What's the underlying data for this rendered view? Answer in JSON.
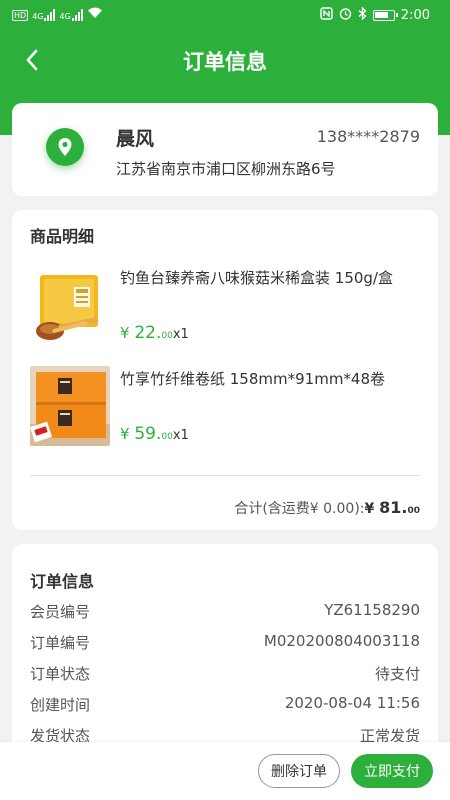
{
  "status_bar": {
    "time": "2:00",
    "network_badge": "HD",
    "signal_label_1": "4G",
    "signal_label_2": "4G"
  },
  "header": {
    "title": "订单信息",
    "back_icon": "chevron-left-icon"
  },
  "address": {
    "icon": "location-pin-icon",
    "name": "晨风",
    "phone": "138****2879",
    "detail": "江苏省南京市浦口区柳洲东路6号"
  },
  "goods": {
    "section_title": "商品明细",
    "items": [
      {
        "name": "钓鱼台臻养斋八味猴菇米稀盒装 150g/盒",
        "currency": "¥",
        "price_int": "22.",
        "price_dec": "00",
        "qty": "x1"
      },
      {
        "name": "竹享竹纤维卷纸  158mm*91mm*48卷",
        "currency": "¥",
        "price_int": "59.",
        "price_dec": "00",
        "qty": "x1"
      }
    ],
    "total_label": "合计(含运费¥ 0.00):",
    "total_currency": "¥ ",
    "total_int": "81.",
    "total_dec": "00"
  },
  "order_info": {
    "section_title": "订单信息",
    "rows": [
      {
        "label": "会员编号",
        "value": "YZ61158290"
      },
      {
        "label": "订单编号",
        "value": "M020200804003118"
      },
      {
        "label": "订单状态",
        "value": "待支付"
      },
      {
        "label": "创建时间",
        "value": "2020-08-04 11:56"
      },
      {
        "label": "发货状态",
        "value": "正常发货"
      }
    ]
  },
  "actions": {
    "delete_label": "删除订单",
    "pay_label": "立即支付"
  },
  "colors": {
    "brand_green": "#2db03b",
    "background": "#f2f2f2"
  }
}
